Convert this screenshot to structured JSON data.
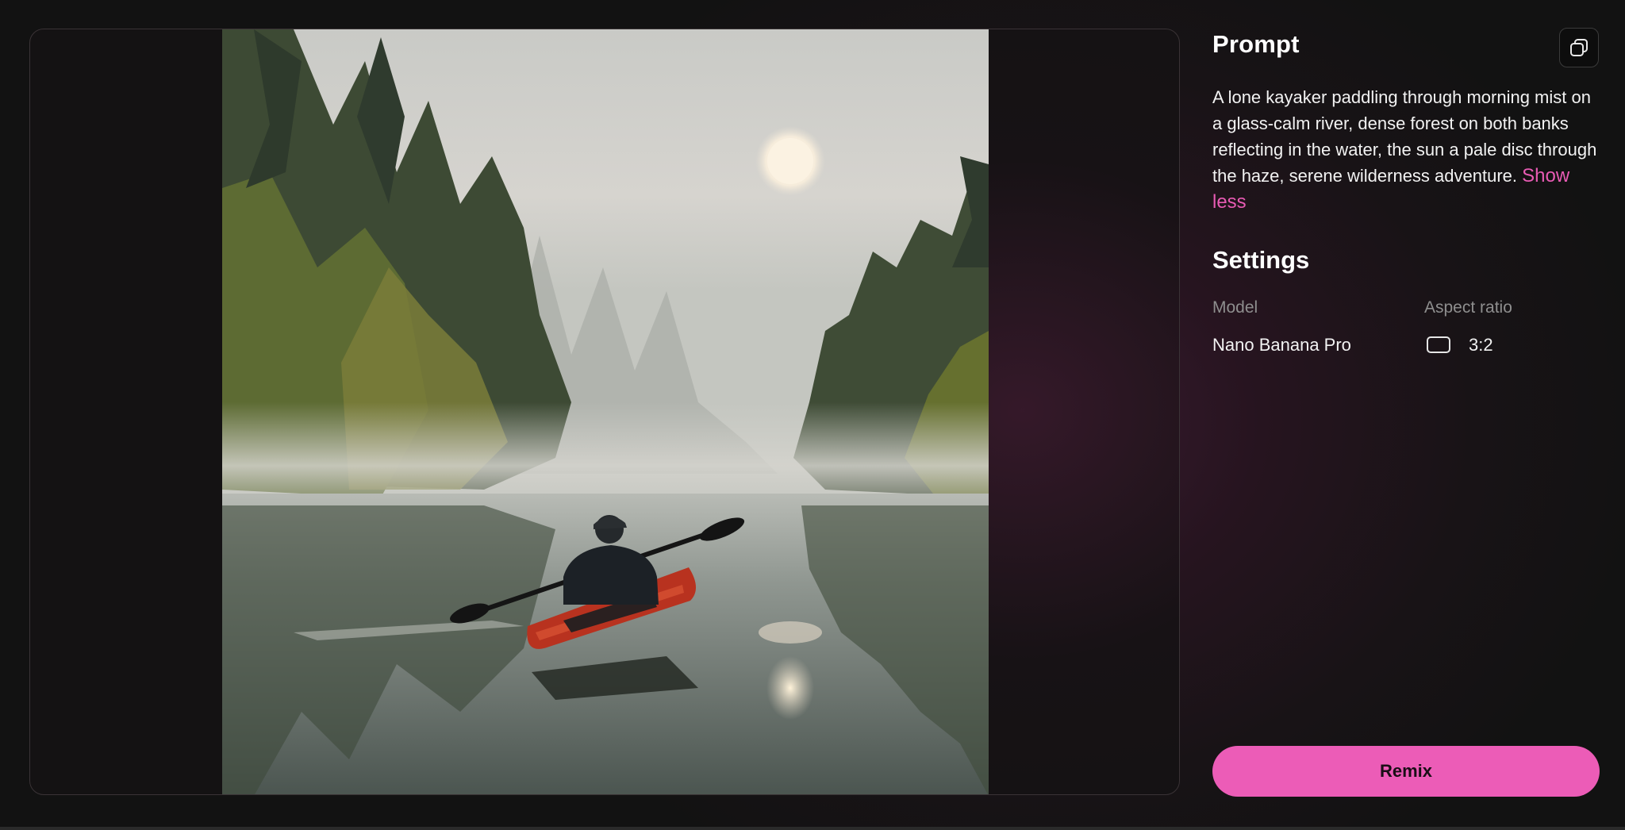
{
  "prompt": {
    "heading": "Prompt",
    "text": "A lone kayaker paddling through morning mist on a glass-calm river, dense forest on both banks reflecting in the water, the sun a pale disc through the haze, serene wilderness adventure.",
    "toggle_label": "Show less",
    "copy_icon": "copy-icon"
  },
  "settings": {
    "heading": "Settings",
    "model_label": "Model",
    "model_value": "Nano Banana Pro",
    "aspect_label": "Aspect ratio",
    "aspect_value": "3:2",
    "aspect_icon": "aspect-ratio-icon"
  },
  "actions": {
    "remix_label": "Remix"
  },
  "colors": {
    "accent": "#ec5cb7",
    "link": "#e85bb4",
    "background": "#121212"
  }
}
